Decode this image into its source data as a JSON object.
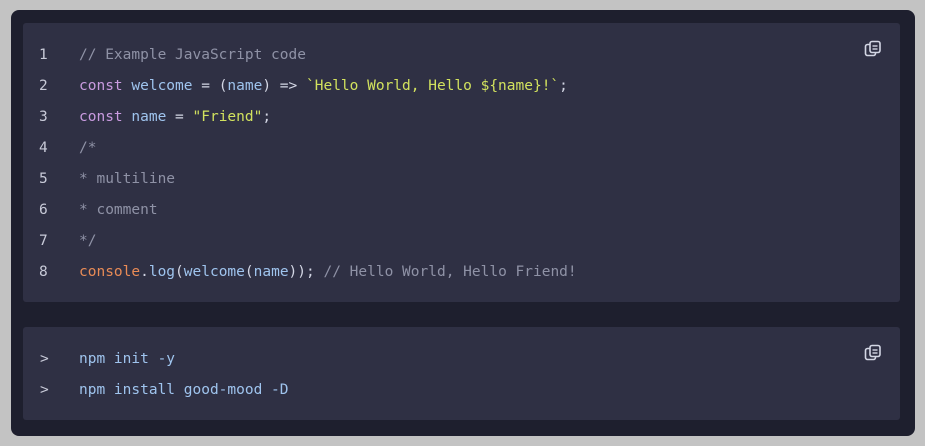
{
  "code_block": {
    "copy_icon": "copy-icon",
    "lines": [
      {
        "num": "1",
        "tokens": [
          {
            "t": "// Example JavaScript code",
            "k": "comment"
          }
        ]
      },
      {
        "num": "2",
        "tokens": [
          {
            "t": "const",
            "k": "keyword"
          },
          {
            "t": " ",
            "k": "punct"
          },
          {
            "t": "welcome",
            "k": "ident"
          },
          {
            "t": " = (",
            "k": "punct"
          },
          {
            "t": "name",
            "k": "ident"
          },
          {
            "t": ") => ",
            "k": "punct"
          },
          {
            "t": "`Hello World, Hello ${name}!`",
            "k": "string"
          },
          {
            "t": ";",
            "k": "punct"
          }
        ]
      },
      {
        "num": "3",
        "tokens": [
          {
            "t": "const",
            "k": "keyword"
          },
          {
            "t": " ",
            "k": "punct"
          },
          {
            "t": "name",
            "k": "ident"
          },
          {
            "t": " = ",
            "k": "punct"
          },
          {
            "t": "\"Friend\"",
            "k": "string"
          },
          {
            "t": ";",
            "k": "punct"
          }
        ]
      },
      {
        "num": "4",
        "tokens": [
          {
            "t": "/*",
            "k": "comment"
          }
        ]
      },
      {
        "num": "5",
        "tokens": [
          {
            "t": "* multiline",
            "k": "comment"
          }
        ]
      },
      {
        "num": "6",
        "tokens": [
          {
            "t": "* comment",
            "k": "comment"
          }
        ]
      },
      {
        "num": "7",
        "tokens": [
          {
            "t": "*/",
            "k": "comment"
          }
        ]
      },
      {
        "num": "8",
        "tokens": [
          {
            "t": "console",
            "k": "func"
          },
          {
            "t": ".",
            "k": "punct"
          },
          {
            "t": "log",
            "k": "ident"
          },
          {
            "t": "(",
            "k": "punct"
          },
          {
            "t": "welcome",
            "k": "ident"
          },
          {
            "t": "(",
            "k": "punct"
          },
          {
            "t": "name",
            "k": "ident"
          },
          {
            "t": "));",
            "k": "punct"
          },
          {
            "t": " // Hello World, Hello Friend!",
            "k": "comment"
          }
        ]
      }
    ]
  },
  "terminal_block": {
    "copy_icon": "copy-icon",
    "prompt_symbol": ">",
    "lines": [
      {
        "cmd": "npm init -y"
      },
      {
        "cmd": "npm install good-mood -D"
      }
    ]
  },
  "colors": {
    "page_bg": "#c3c3c3",
    "frame_bg": "#1e1f2e",
    "block_bg": "#2f3044",
    "keyword": "#c99be0",
    "identifier": "#9fc4ee",
    "string": "#d2e25e",
    "comment": "#8f92a6",
    "function": "#e98b56"
  }
}
